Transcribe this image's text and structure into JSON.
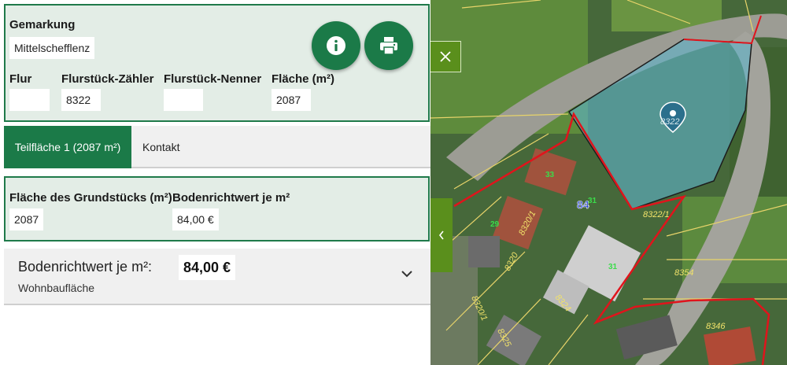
{
  "parcel": {
    "gemarkung_label": "Gemarkung",
    "gemarkung_value": "Mittelschefflenz",
    "flur_label": "Flur",
    "flur_value": "",
    "zaehler_label": "Flurstück-Zähler",
    "zaehler_value": "8322",
    "nenner_label": "Flurstück-Nenner",
    "nenner_value": "",
    "flaeche_label": "Fläche (m²)",
    "flaeche_value": "2087"
  },
  "actions": {
    "info_icon": "info-icon",
    "print_icon": "print-icon"
  },
  "tabs": [
    {
      "label": "Teilfläche 1 (2087 m²)",
      "active": true
    },
    {
      "label": "Kontakt",
      "active": false
    }
  ],
  "teilflaeche": {
    "grundstueck_label": "Fläche des Grundstücks (m²)",
    "grundstueck_value": "2087",
    "brw_label": "Bodenrichtwert je m²",
    "brw_value": "84,00 €"
  },
  "bodenrichtwert": {
    "title": "Bodenrichtwert je m²:",
    "value": "84,00 €",
    "subtitle": "Wohnbaufläche"
  },
  "map": {
    "parcel_labels": [
      "8322/1",
      "8320/1",
      "8320",
      "8324",
      "8320/1",
      "8325",
      "8354",
      "8346",
      "8322"
    ],
    "house_number": "84",
    "building_numbers": [
      "33",
      "31",
      "29",
      "31"
    ]
  },
  "colors": {
    "accent": "#1b7a48",
    "panel_bg": "#e3ede6",
    "map_button": "#5a8f1c",
    "parcel_outline": "#e0141c",
    "selected_fill": "#5fb3c9"
  }
}
